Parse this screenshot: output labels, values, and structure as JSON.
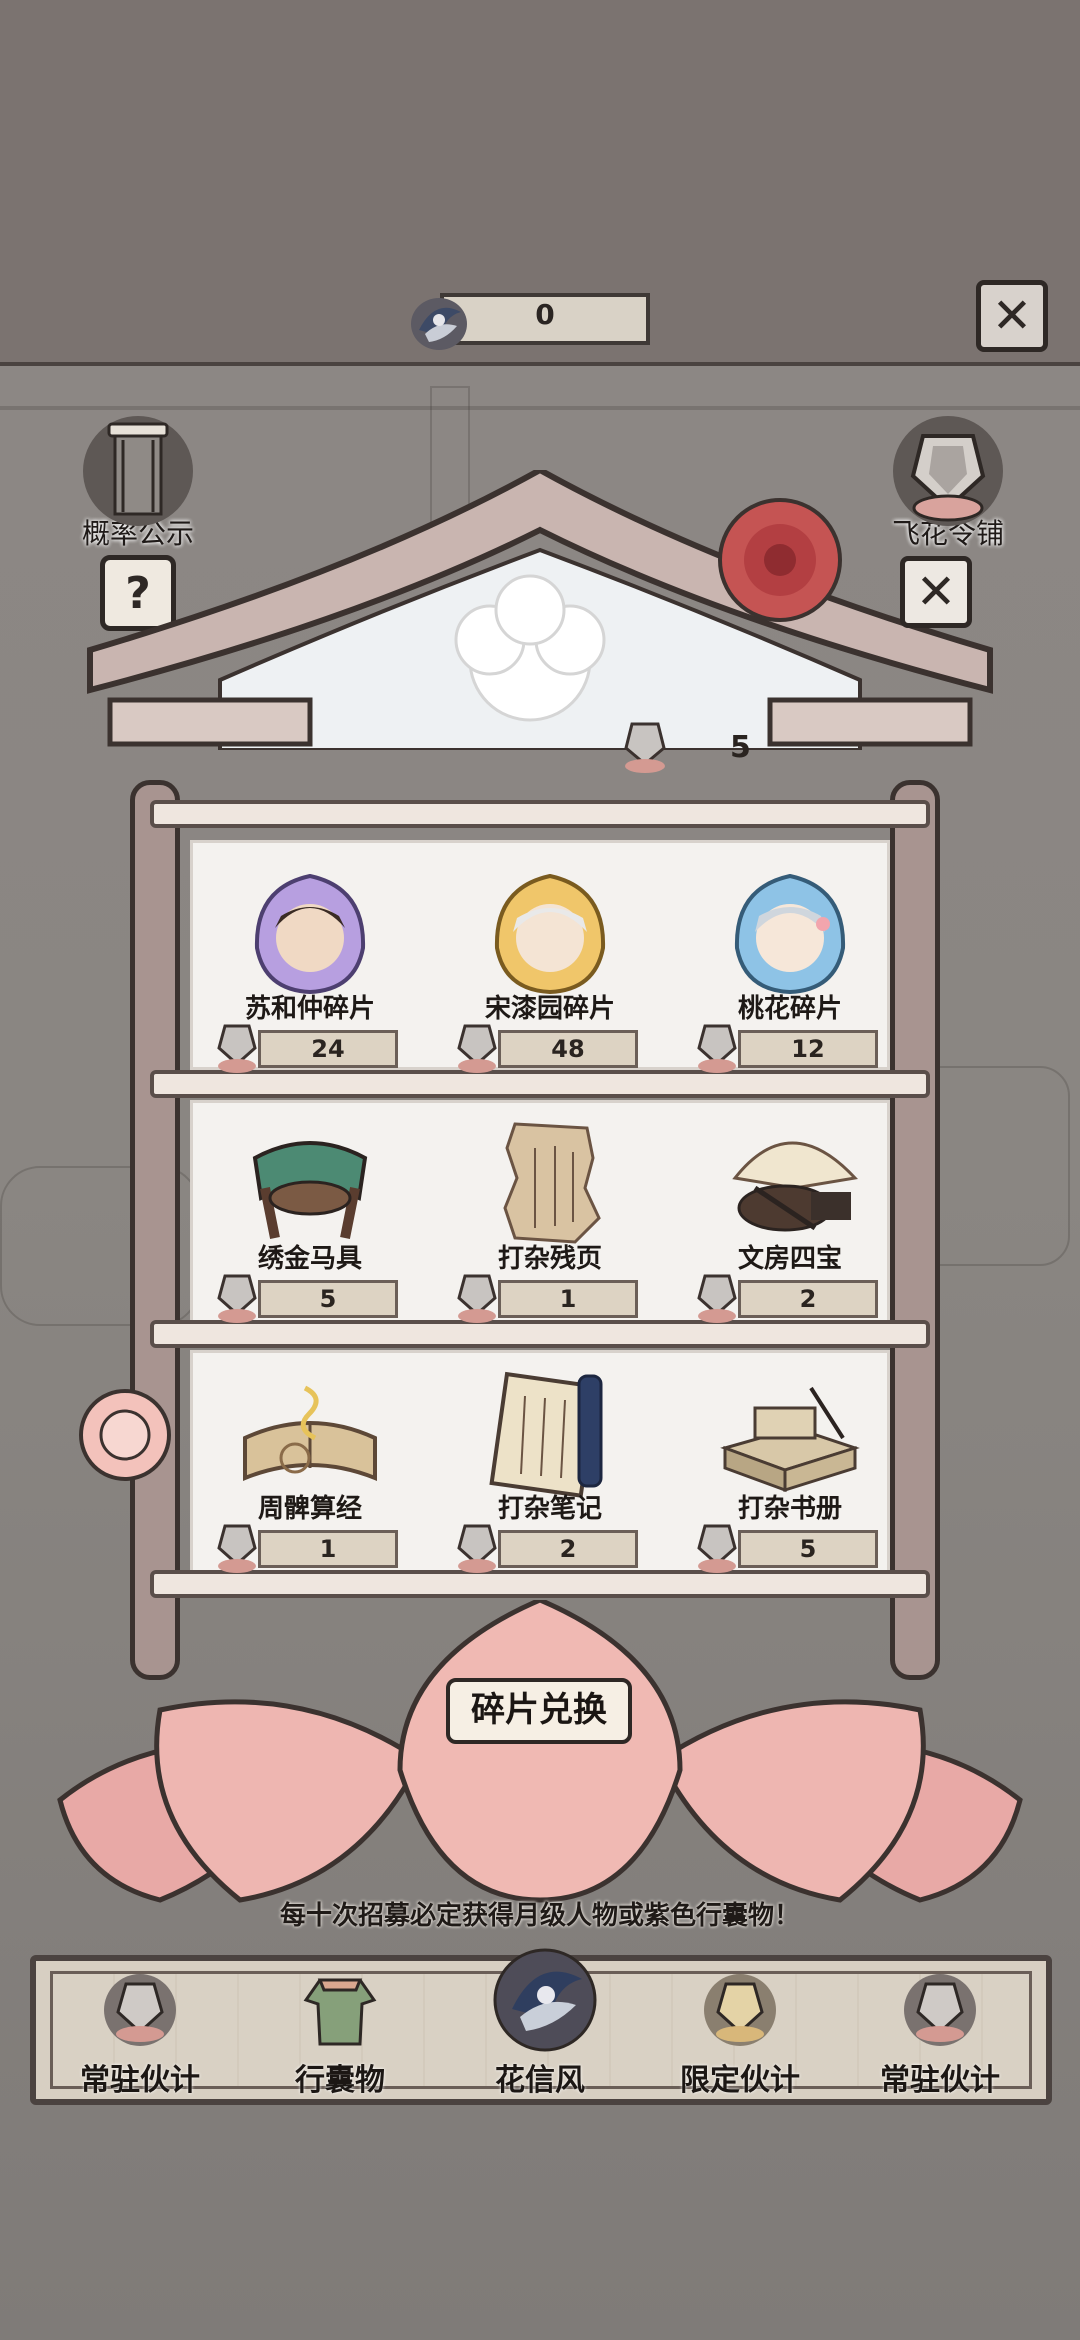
{
  "header": {
    "currency_value": "0",
    "currency_icon": "flower-token-icon"
  },
  "side": {
    "probability_label": "概率公示",
    "shop_label": "飞花令铺",
    "help_symbol": "?",
    "close_symbol": "✕"
  },
  "cabinet": {
    "fragment_count": "5",
    "exchange_label": "碎片兑换"
  },
  "items": [
    {
      "name": "苏和仲碎片",
      "count": "24",
      "art": "character-fragment-purple"
    },
    {
      "name": "宋漆园碎片",
      "count": "48",
      "art": "character-fragment-gold"
    },
    {
      "name": "桃花碎片",
      "count": "12",
      "art": "character-fragment-blue"
    },
    {
      "name": "绣金马具",
      "count": "5",
      "art": "saddle-icon"
    },
    {
      "name": "打杂残页",
      "count": "1",
      "art": "torn-page-icon"
    },
    {
      "name": "文房四宝",
      "count": "2",
      "art": "stationery-icon"
    },
    {
      "name": "周髀算经",
      "count": "1",
      "art": "ancient-book-icon"
    },
    {
      "name": "打杂笔记",
      "count": "2",
      "art": "scroll-notes-icon"
    },
    {
      "name": "打杂书册",
      "count": "5",
      "art": "book-stack-icon"
    }
  ],
  "notice": "每十次招募必定获得月级人物或紫色行囊物！",
  "tabs": [
    {
      "label": "常驻伙计",
      "icon": "fragment-icon"
    },
    {
      "label": "行囊物",
      "icon": "robe-icon"
    },
    {
      "label": "花信风",
      "icon": "flower-token-icon",
      "active": true
    },
    {
      "label": "限定伙计",
      "icon": "golden-fragment-icon"
    },
    {
      "label": "常驻伙计",
      "icon": "fragment-icon"
    }
  ],
  "colors": {
    "background": "#7d7572",
    "panel": "#f4f2ef",
    "lotus": "#e8a9a6",
    "wood": "#a89490",
    "ink": "#2e2825"
  }
}
